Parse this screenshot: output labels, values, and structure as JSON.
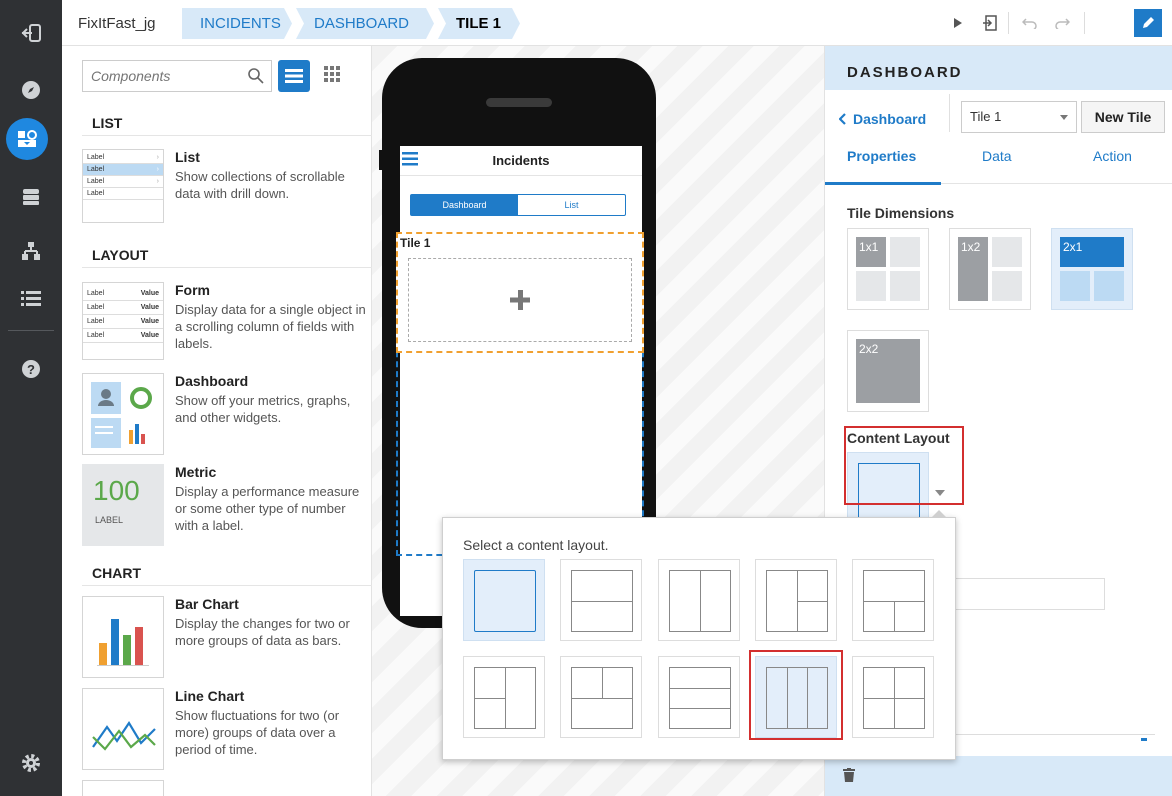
{
  "topbar": {
    "app_name": "FixItFast_jg",
    "crumbs": [
      "INCIDENTS",
      "DASHBOARD",
      "TILE 1"
    ]
  },
  "rail": {
    "items": [
      "sign-out-icon",
      "compass-icon",
      "dashboard-designer-icon",
      "database-icon",
      "hierarchy-icon",
      "list-icon",
      "help-icon",
      "settings-icon"
    ],
    "accent": "#1f88e0"
  },
  "components": {
    "search_placeholder": "Components",
    "sections": {
      "list": "LIST",
      "layout": "LAYOUT",
      "chart": "CHART"
    },
    "items": {
      "list": {
        "title": "List",
        "desc": "Show collections of scrollable data with drill down.",
        "thumb_label": "Label"
      },
      "form": {
        "title": "Form",
        "desc": "Display data for a single object in a scrolling column of fields with labels.",
        "thumb_label": "Label",
        "thumb_value": "Value"
      },
      "dashboard": {
        "title": "Dashboard",
        "desc": "Show off your metrics, graphs, and other widgets."
      },
      "metric": {
        "title": "Metric",
        "desc": "Display a performance measure or some other type of number with a label.",
        "thumb_number": "100",
        "thumb_label": "LABEL"
      },
      "bar": {
        "title": "Bar Chart",
        "desc": "Display the changes for two or more groups of data as bars."
      },
      "line": {
        "title": "Line Chart",
        "desc": "Show fluctuations for two (or more) groups of data over a period of time."
      }
    }
  },
  "phone": {
    "title": "Incidents",
    "tabs": [
      "Dashboard",
      "List"
    ],
    "tile_label": "Tile 1"
  },
  "props": {
    "header": "DASHBOARD",
    "back_label": "Dashboard",
    "tile_select": "Tile 1",
    "new_tile": "New Tile",
    "tabs": [
      "Properties",
      "Data",
      "Action"
    ],
    "tile_dimensions_label": "Tile Dimensions",
    "dims": [
      "1x1",
      "1x2",
      "2x1",
      "2x2"
    ],
    "selected_dim": "2x1",
    "content_layout_label": "Content Layout"
  },
  "popup": {
    "title": "Select a content layout."
  },
  "colors": {
    "accent": "#1f7bc8",
    "highlight": "#d32f2f",
    "selected_bg": "#e3eefa"
  }
}
